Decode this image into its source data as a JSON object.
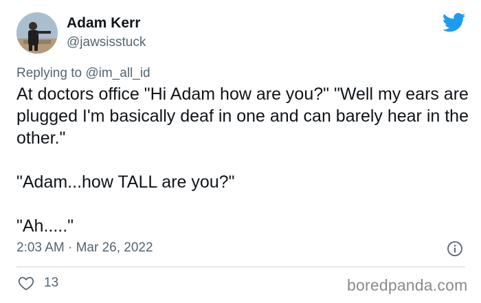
{
  "author": {
    "display_name": "Adam Kerr",
    "handle": "@jawsisstuck"
  },
  "reply": {
    "prefix": "Replying to ",
    "mention": "@im_all_id"
  },
  "tweet": {
    "lines": [
      "At doctors office \"Hi Adam how are you?\" \"Well my ears are plugged  I'm basically deaf in one and can barely hear in the other.\"",
      "\"Adam...how TALL are you?\"",
      "\"Ah.....\""
    ],
    "timestamp": "2:03 AM · Mar 26, 2022",
    "like_count": "13"
  },
  "watermark": "boredpanda.com",
  "icons": {
    "logo": "twitter-bird-icon",
    "info": "info-icon",
    "like": "heart-icon"
  },
  "colors": {
    "twitter_blue": "#1d9bf0",
    "secondary_text": "#536471",
    "primary_text": "#0f1419"
  }
}
